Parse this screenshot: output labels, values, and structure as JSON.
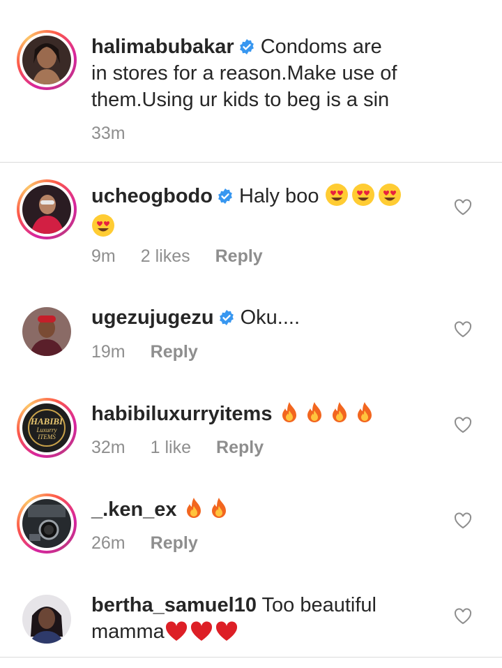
{
  "caption": {
    "username": "halimabubakar",
    "text_line1": "Condoms are",
    "text_line2": "in stores for a reason.Make use of",
    "text_line3": "them.Using ur kids to beg is a sin",
    "time": "33m"
  },
  "comments": [
    {
      "username": "ucheogbodo",
      "verified": true,
      "text": "Haly boo",
      "emojis": "heart-eyes x4",
      "time": "9m",
      "likes": "2 likes",
      "reply": "Reply"
    },
    {
      "username": "ugezujugezu",
      "verified": true,
      "text": "Oku....",
      "time": "19m",
      "reply": "Reply"
    },
    {
      "username": "habibiluxurryitems",
      "verified": false,
      "emojis": "fire x4",
      "time": "32m",
      "likes": "1 like",
      "reply": "Reply",
      "avatar_logo": "HABIBI Luxurry ITEMS"
    },
    {
      "username": "_.ken_ex",
      "verified": false,
      "emojis": "fire x2",
      "time": "26m",
      "reply": "Reply"
    },
    {
      "username": "bertha_samuel10",
      "verified": false,
      "text_line1": "Too beautiful",
      "text_line2": "mamma",
      "emojis": "red-heart x3"
    }
  ],
  "colors": {
    "text": "#262626",
    "muted": "#8e8e8e",
    "verified": "#3897f0",
    "divider": "#dbdbdb"
  }
}
